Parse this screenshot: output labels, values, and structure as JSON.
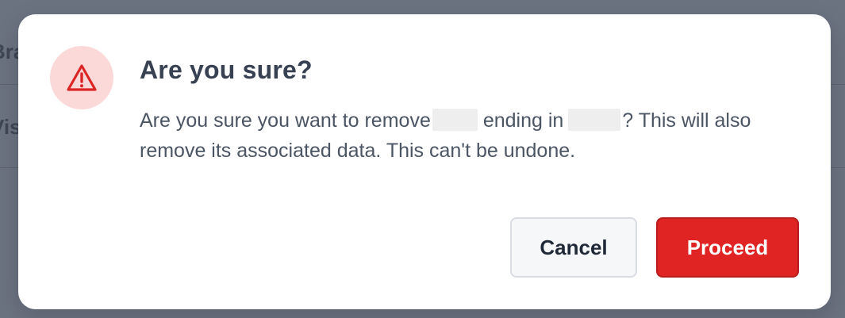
{
  "background": {
    "row1_text": "Bra",
    "row2_text": "Vis"
  },
  "dialog": {
    "icon": "warning-triangle-icon",
    "title": "Are you sure?",
    "message_part1": "Are you sure you want to remove",
    "message_part2": "ending in",
    "message_part3": "? This will also remove its associated data. This can't be undone.",
    "cancel_label": "Cancel",
    "proceed_label": "Proceed"
  },
  "colors": {
    "overlay": "#6b7280",
    "icon_bg": "#fcd9d9",
    "icon_red": "#dc2626",
    "proceed_bg": "#e02424",
    "title_text": "#374151"
  }
}
